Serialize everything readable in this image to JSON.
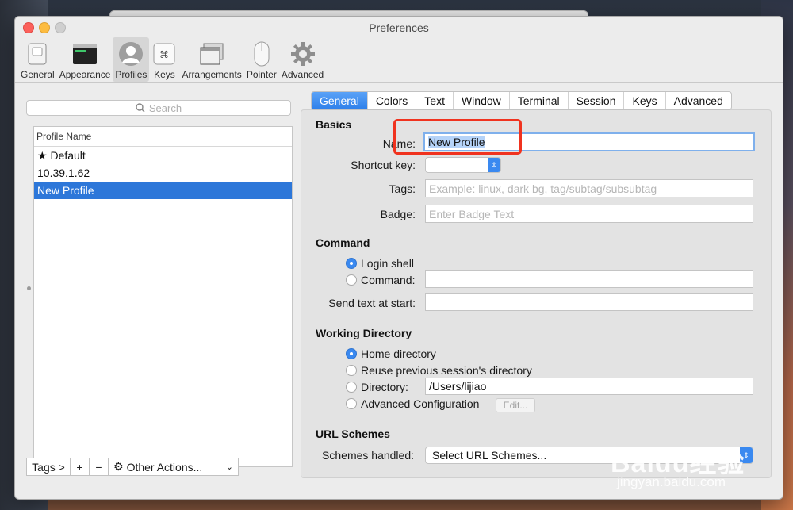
{
  "window": {
    "title": "Preferences"
  },
  "toolbar": {
    "items": [
      {
        "label": "General",
        "icon": "switch-icon"
      },
      {
        "label": "Appearance",
        "icon": "appearance-icon"
      },
      {
        "label": "Profiles",
        "icon": "profile-icon"
      },
      {
        "label": "Keys",
        "icon": "command-key-icon"
      },
      {
        "label": "Arrangements",
        "icon": "arrangements-icon"
      },
      {
        "label": "Pointer",
        "icon": "mouse-icon"
      },
      {
        "label": "Advanced",
        "icon": "gear-icon"
      }
    ],
    "selected": "Profiles"
  },
  "profiles": {
    "search_placeholder": "Search",
    "column_header": "Profile Name",
    "rows": [
      "★ Default",
      "10.39.1.62",
      "New Profile"
    ],
    "selected": "New Profile"
  },
  "bottom_bar": {
    "tags": "Tags >",
    "add": "+",
    "remove": "−",
    "other_actions": "Other Actions..."
  },
  "tabs": [
    "General",
    "Colors",
    "Text",
    "Window",
    "Terminal",
    "Session",
    "Keys",
    "Advanced"
  ],
  "active_tab": "General",
  "basics": {
    "title": "Basics",
    "name_label": "Name:",
    "name_value": "New Profile",
    "shortcut_label": "Shortcut key:",
    "tags_label": "Tags:",
    "tags_placeholder": "Example: linux, dark bg, tag/subtag/subsubtag",
    "badge_label": "Badge:",
    "badge_placeholder": "Enter Badge Text"
  },
  "command": {
    "title": "Command",
    "login_shell": "Login shell",
    "command_label": "Command:",
    "send_text_label": "Send text at start:",
    "selected": "Login shell"
  },
  "working_directory": {
    "title": "Working Directory",
    "home": "Home directory",
    "reuse": "Reuse previous session's directory",
    "directory_label": "Directory:",
    "directory_value": "/Users/lijiao",
    "advanced": "Advanced Configuration",
    "edit": "Edit...",
    "selected": "Home directory"
  },
  "url_schemes": {
    "title": "URL Schemes",
    "handled_label": "Schemes handled:",
    "select_value": "Select URL Schemes..."
  },
  "watermark": {
    "brand": "Baidu经验",
    "site": "jingyan.baidu.com"
  },
  "colors": {
    "accent": "#2d77d9",
    "highlight": "#f0331f"
  }
}
